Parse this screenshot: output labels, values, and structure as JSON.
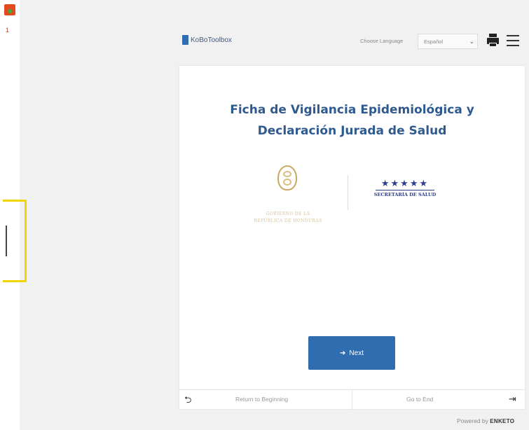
{
  "sidebar": {
    "page_counter": "1"
  },
  "header": {
    "brand": "KoBoToolbox",
    "language_label": "Choose Language",
    "language_selected": "Español",
    "print_icon": "printer-icon",
    "menu_icon": "hamburger-icon"
  },
  "form": {
    "title_line1": "Ficha de Vigilancia Epidemiológica y",
    "title_line2": "Declaración Jurada de Salud",
    "logo_left_line1": "GOBIERNO DE LA",
    "logo_left_line2": "REPÚBLICA DE HONDURAS",
    "logo_right_stars": "★★★★★",
    "logo_right_text": "SECRETARÍA DE SALUD",
    "next_label": "Next"
  },
  "footer": {
    "return_label": "Return to Beginning",
    "goto_label": "Go to End",
    "powered_prefix": "Powered by",
    "powered_brand": "ENKETO"
  },
  "colors": {
    "accent": "#2f6db0",
    "title": "#2e5a8f",
    "highlight": "#f2d400"
  }
}
